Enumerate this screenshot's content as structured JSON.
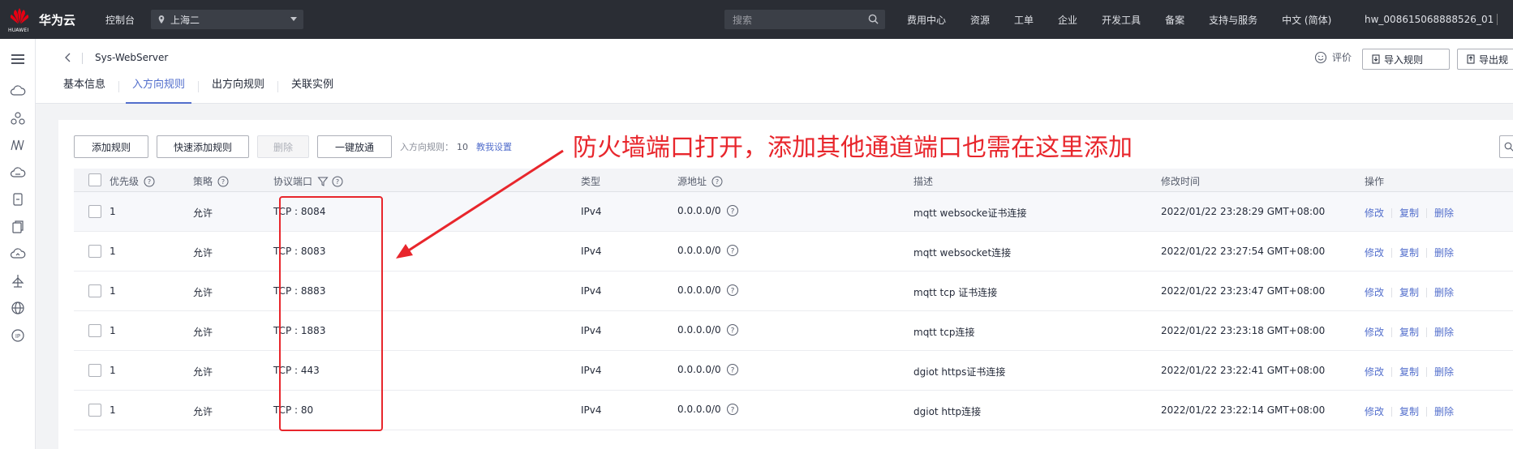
{
  "topbar": {
    "brand_sub": "HUAWEI",
    "brand": "华为云",
    "console": "控制台",
    "region": "上海二",
    "search_placeholder": "搜索",
    "nav": [
      "费用中心",
      "资源",
      "工单",
      "企业",
      "开发工具",
      "备案",
      "支持与服务",
      "中文 (简体)"
    ],
    "user": "hw_008615068888526_01"
  },
  "sidebar": {
    "icons": [
      "menu-icon",
      "cloud-icon",
      "network-icon",
      "waves-icon",
      "cloud-storage-icon",
      "document-icon",
      "copy-doc-icon",
      "cloud-upload-icon",
      "balance-icon",
      "globe-icon",
      "ip-icon"
    ]
  },
  "header": {
    "title": "Sys-WebServer",
    "rate_label": "评价",
    "import_label": "导入规则",
    "export_label": "导出规",
    "tabs": [
      "基本信息",
      "入方向规则",
      "出方向规则",
      "关联实例"
    ],
    "active_tab": 1
  },
  "toolbar": {
    "add": "添加规则",
    "quick_add": "快速添加规则",
    "delete": "删除",
    "one_click": "一键放通",
    "count_label": "入方向规则：",
    "count": "10",
    "help_link": "教我设置"
  },
  "table": {
    "columns": [
      "优先级",
      "策略",
      "协议端口",
      "类型",
      "源地址",
      "描述",
      "修改时间",
      "操作"
    ],
    "rows": [
      {
        "priority": "1",
        "policy": "允许",
        "port": "TCP : 8084",
        "type": "IPv4",
        "source": "0.0.0.0/0",
        "desc": "mqtt websocke证书连接",
        "time": "2022/01/22 23:28:29 GMT+08:00"
      },
      {
        "priority": "1",
        "policy": "允许",
        "port": "TCP : 8083",
        "type": "IPv4",
        "source": "0.0.0.0/0",
        "desc": "mqtt websocket连接",
        "time": "2022/01/22 23:27:54 GMT+08:00"
      },
      {
        "priority": "1",
        "policy": "允许",
        "port": "TCP : 8883",
        "type": "IPv4",
        "source": "0.0.0.0/0",
        "desc": "mqtt tcp 证书连接",
        "time": "2022/01/22 23:23:47 GMT+08:00"
      },
      {
        "priority": "1",
        "policy": "允许",
        "port": "TCP : 1883",
        "type": "IPv4",
        "source": "0.0.0.0/0",
        "desc": "mqtt tcp连接",
        "time": "2022/01/22 23:23:18 GMT+08:00"
      },
      {
        "priority": "1",
        "policy": "允许",
        "port": "TCP : 443",
        "type": "IPv4",
        "source": "0.0.0.0/0",
        "desc": "dgiot https证书连接",
        "time": "2022/01/22 23:22:41 GMT+08:00"
      },
      {
        "priority": "1",
        "policy": "允许",
        "port": "TCP : 80",
        "type": "IPv4",
        "source": "0.0.0.0/0",
        "desc": "dgiot http连接",
        "time": "2022/01/22 23:22:14 GMT+08:00"
      }
    ],
    "ops": [
      "修改",
      "复制",
      "删除"
    ]
  },
  "annotation": {
    "text": "防火墙端口打开，添加其他通道端口也需在这里添加"
  },
  "colors": {
    "topbar_bg": "#2a2d34",
    "accent": "#526ecc",
    "annotation_red": "#e8262c",
    "logo_red": "#e60012"
  }
}
